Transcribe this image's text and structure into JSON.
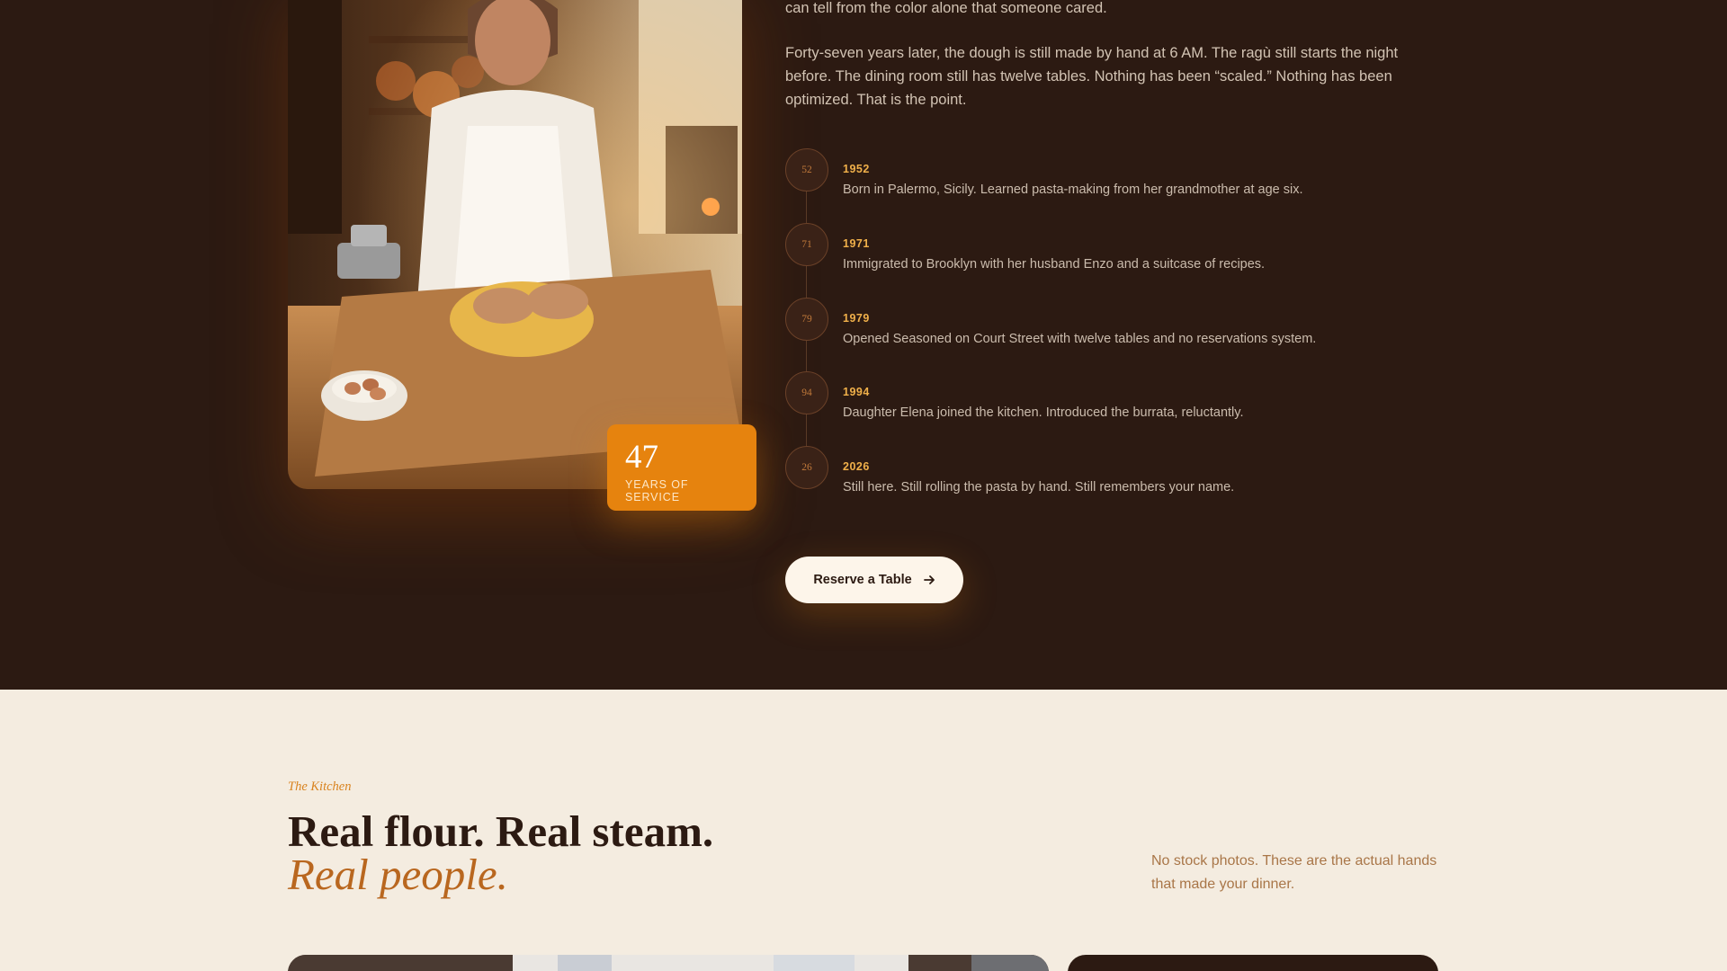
{
  "story": {
    "paragraph1": "can tell from the color alone that someone cared.",
    "paragraph2": "Forty-seven years later, the dough is still made by hand at 6 AM. The ragù still starts the night before. The dining room still has twelve tables. Nothing has been “scaled.” Nothing has been optimized. That is the point.",
    "badge": {
      "number": "47",
      "label": "YEARS OF SERVICE"
    },
    "timeline": [
      {
        "marker": "52",
        "year": "1952",
        "text": "Born in Palermo, Sicily. Learned pasta-making from her grandmother at age six."
      },
      {
        "marker": "71",
        "year": "1971",
        "text": "Immigrated to Brooklyn with her husband Enzo and a suitcase of recipes."
      },
      {
        "marker": "79",
        "year": "1979",
        "text": "Opened Seasoned on Court Street with twelve tables and no reservations system."
      },
      {
        "marker": "94",
        "year": "1994",
        "text": "Daughter Elena joined the kitchen. Introduced the burrata, reluctantly."
      },
      {
        "marker": "26",
        "year": "2026",
        "text": "Still here. Still rolling the pasta by hand. Still remembers your name."
      }
    ],
    "cta_label": "Reserve a Table"
  },
  "kitchen": {
    "eyebrow": "The Kitchen",
    "headline": "Real flour. Real steam.",
    "headline_emphasis": "Real people.",
    "side_note": "No stock photos. These are the actual hands that made your dinner."
  },
  "colors": {
    "dark_bg": "#2c1a12",
    "accent": "#e6830e",
    "year_gold": "#f0b04a",
    "light_bg": "#f4ece0",
    "emphasis": "#b9671f"
  },
  "icons": {
    "cta_icon": "arrow-right-icon"
  }
}
